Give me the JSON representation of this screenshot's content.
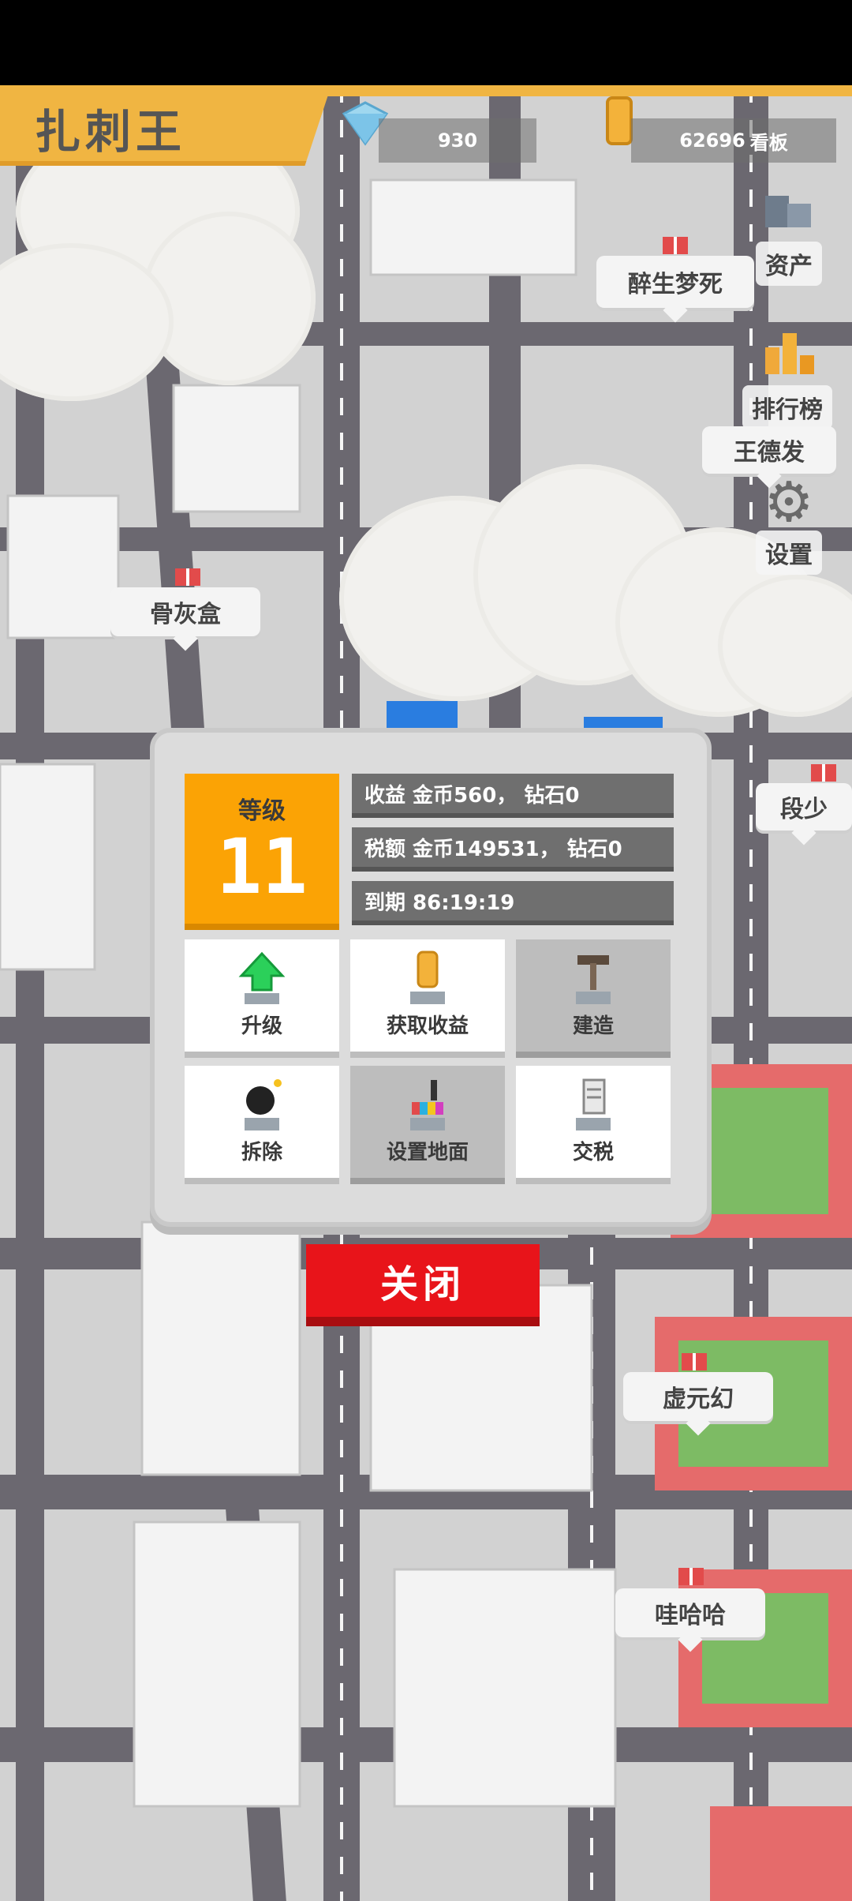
{
  "game_title": "扎刺王",
  "resources": {
    "diamonds": "930",
    "gold": "62696",
    "board_label": "看板"
  },
  "side_buttons": {
    "assets": "资产",
    "leaderboard": "排行榜",
    "player": "王德发",
    "settings": "设置"
  },
  "map_labels": {
    "tag1": "醉生梦死",
    "tag2": "骨灰盒",
    "tag3": "段少",
    "tag4": "虚元幻",
    "tag5": "哇哈哈"
  },
  "panel": {
    "level_label": "等级",
    "level_value": "11",
    "income": "收益 金币560， 钻石0",
    "tax": "税额 金币149531， 钻石0",
    "expiry": "到期 86:19:19",
    "actions": [
      {
        "label": "升级",
        "icon": "upgrade-arrow-icon",
        "enabled": true
      },
      {
        "label": "获取收益",
        "icon": "coin-collect-icon",
        "enabled": true
      },
      {
        "label": "建造",
        "icon": "hammer-build-icon",
        "enabled": false
      },
      {
        "label": "拆除",
        "icon": "bomb-demolish-icon",
        "enabled": true
      },
      {
        "label": "设置地面",
        "icon": "paint-ground-icon",
        "enabled": false
      },
      {
        "label": "交税",
        "icon": "tax-document-icon",
        "enabled": true
      }
    ]
  },
  "close_label": "关闭",
  "colors": {
    "accent_orange": "#fba305",
    "banner_yellow": "#f0b542",
    "close_red": "#e8141a"
  }
}
